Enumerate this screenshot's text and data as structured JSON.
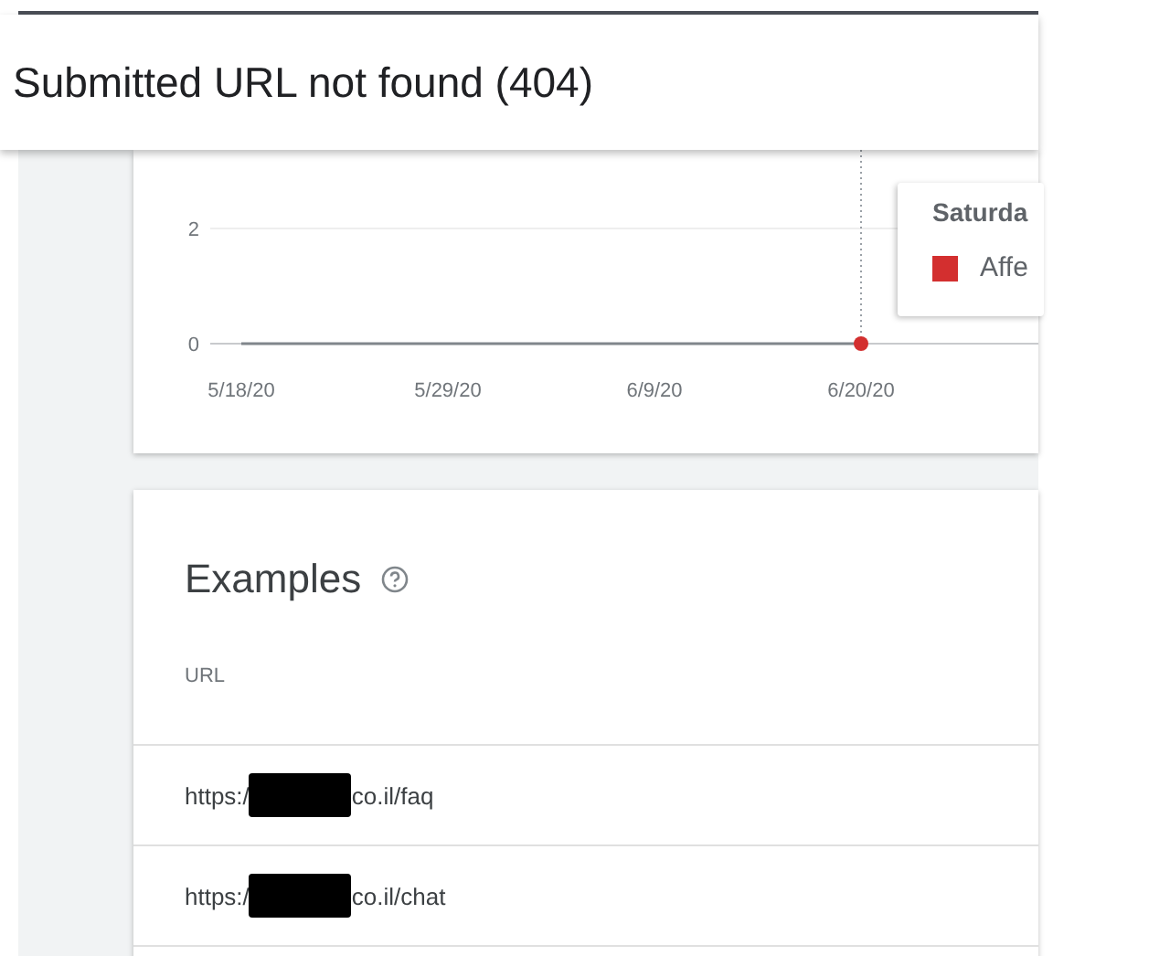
{
  "header": {
    "title": "Submitted URL not found (404)"
  },
  "chart": {
    "chart_data": {
      "type": "line",
      "x": [
        "5/18/20",
        "5/29/20",
        "6/9/20",
        "6/20/20"
      ],
      "yticks": [
        0,
        2
      ],
      "ylim": [
        0,
        2
      ],
      "series": [
        {
          "color": "#80868b",
          "values": [
            0,
            0,
            0,
            0
          ]
        }
      ]
    },
    "tooltip": {
      "title": "Saturda",
      "legend": "Affe",
      "color": "#d32f2f"
    }
  },
  "examples": {
    "title": "Examples",
    "column": "URL",
    "rows": [
      {
        "prefix": "https:/",
        "suffix": "co.il/faq"
      },
      {
        "prefix": "https:/",
        "suffix": "co.il/chat"
      }
    ]
  }
}
